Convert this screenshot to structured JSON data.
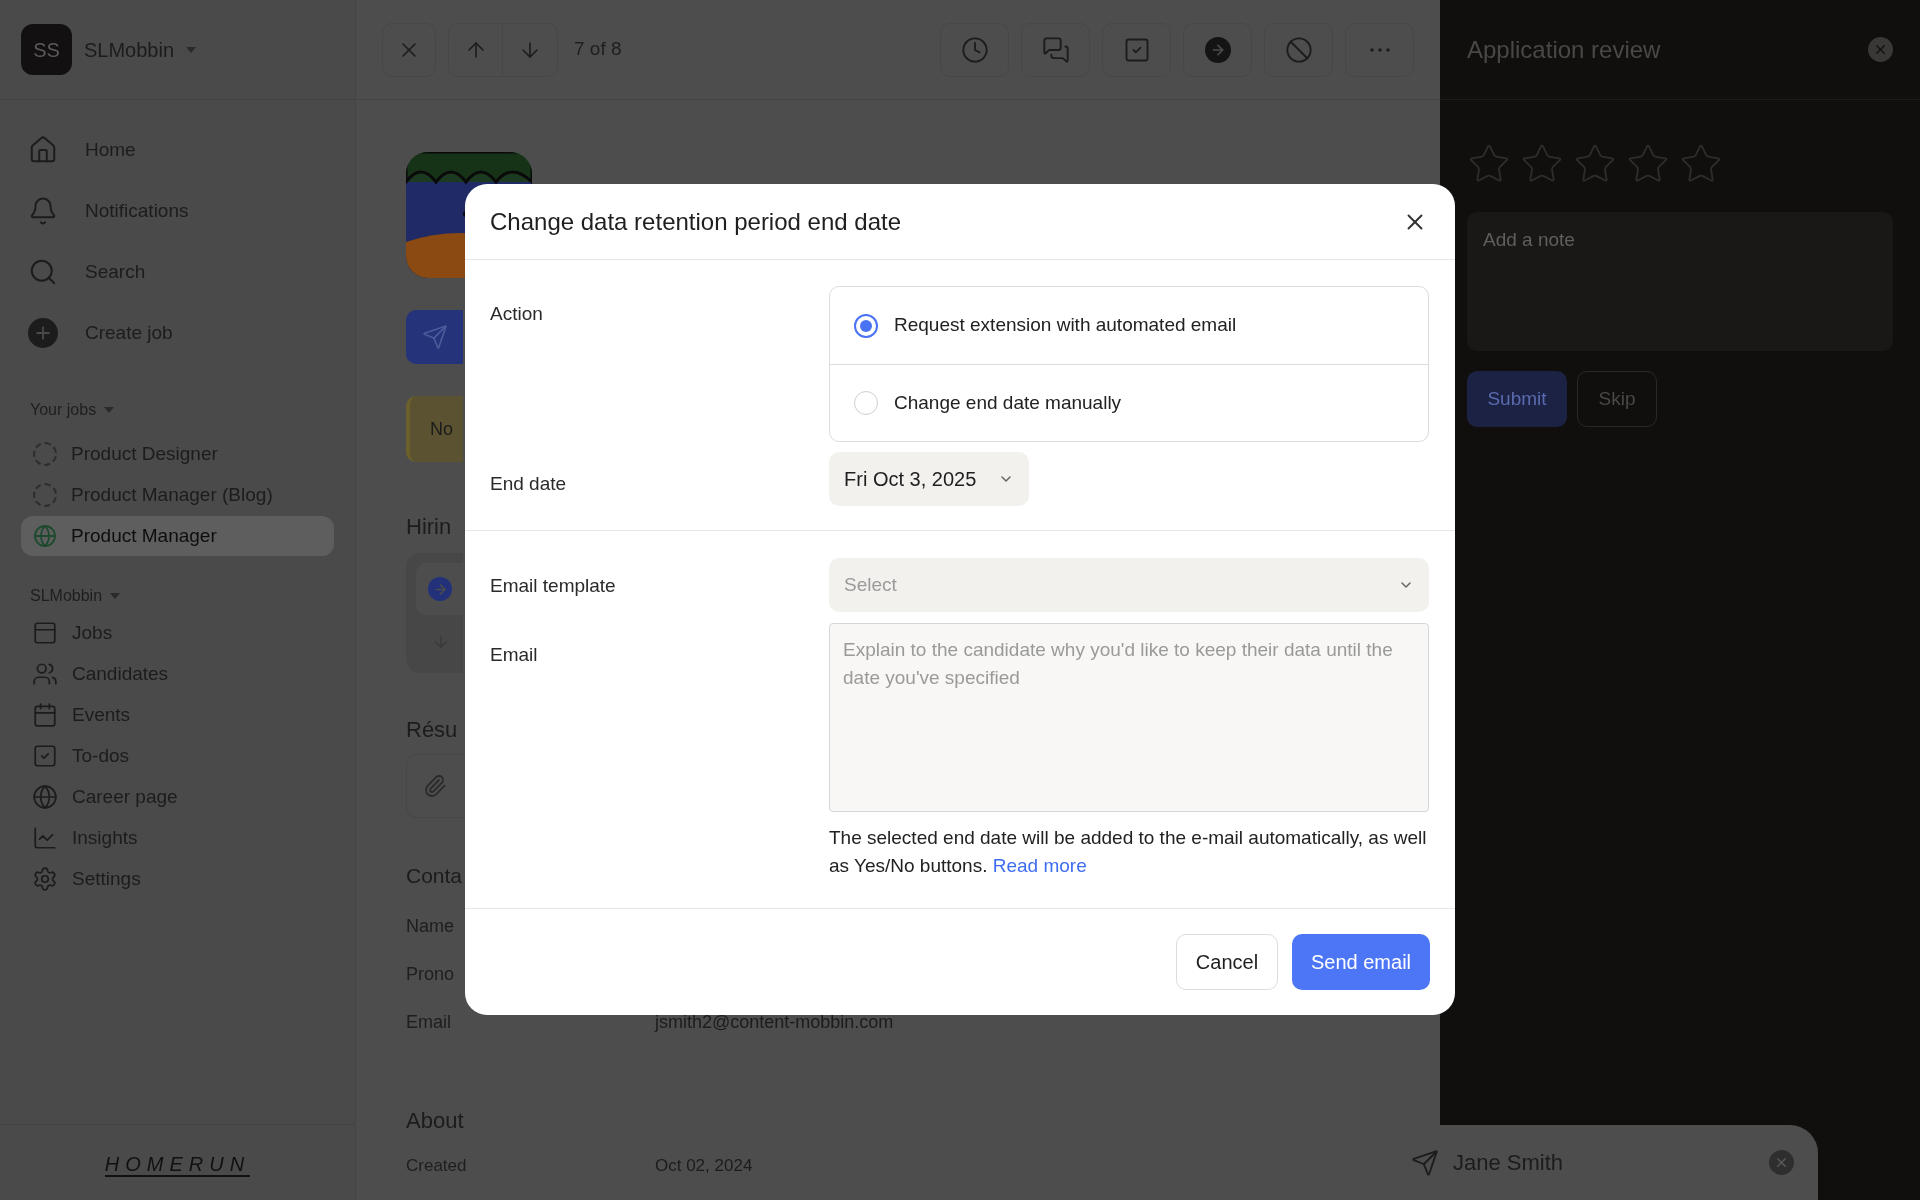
{
  "workspace": {
    "initials": "SS",
    "name": "SLMobbin"
  },
  "nav": [
    "Home",
    "Notifications",
    "Search",
    "Create job"
  ],
  "your_jobs": {
    "label": "Your jobs",
    "items": [
      {
        "label": "Product Designer",
        "kind": "draft",
        "selected": false
      },
      {
        "label": "Product Manager (Blog)",
        "kind": "draft",
        "selected": false
      },
      {
        "label": "Product Manager",
        "kind": "published",
        "selected": true
      }
    ]
  },
  "org": {
    "label": "SLMobbin",
    "items": [
      "Jobs",
      "Candidates",
      "Events",
      "To-dos",
      "Career page",
      "Insights",
      "Settings"
    ]
  },
  "logo": "HOMERUN",
  "toolbar": {
    "position": "7 of 8"
  },
  "profile": {
    "banner": "No",
    "sections": [
      "Hirin",
      "Résu",
      "Conta"
    ],
    "fields": [
      {
        "label": "Name"
      },
      {
        "label": "Prono"
      },
      {
        "label": "Email",
        "value": "jsmith2@content-mobbin.com"
      }
    ],
    "about": {
      "title": "About",
      "label": "Created",
      "value": "Oct 02, 2024"
    }
  },
  "dialog": {
    "title": "Change data retention period end date",
    "action_label": "Action",
    "actions": [
      {
        "label": "Request extension with automated email",
        "selected": true
      },
      {
        "label": "Change end date manually",
        "selected": false
      }
    ],
    "end_date_label": "End date",
    "end_date": "Fri Oct 3, 2025",
    "template_label": "Email template",
    "template_placeholder": "Select",
    "email_label": "Email",
    "email_placeholder": "Explain to the candidate why you'd like to keep their data until the date you've specified",
    "help": "The selected end date will be added to the e-mail automatically, as well as Yes/No buttons.",
    "help_link": "Read more",
    "cancel": "Cancel",
    "send": "Send email"
  },
  "review": {
    "title": "Application review",
    "stars": 0,
    "note_placeholder": "Add a note",
    "submit": "Submit",
    "skip": "Skip"
  },
  "chat": {
    "name": "Jane Smith"
  }
}
